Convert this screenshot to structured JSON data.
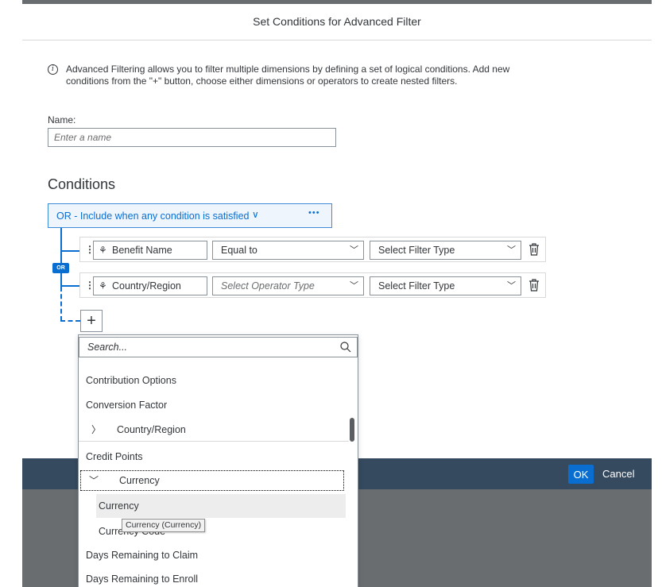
{
  "dialog": {
    "title": "Set Conditions for Advanced Filter",
    "info_text_line1": "Advanced Filtering allows you to filter multiple dimensions by defining a set of logical conditions. Add new",
    "info_text_line2": "conditions from the \"+\" button, choose either dimensions or operators to create nested filters.",
    "name_label": "Name:",
    "name_placeholder": "Enter a name",
    "name_value": "",
    "conditions_heading": "Conditions"
  },
  "group": {
    "label": "OR - Include when any condition is satisfied",
    "chevron": "∨",
    "more": "•••",
    "badge": "OR"
  },
  "conditions": [
    {
      "dimension": "Benefit Name",
      "operator": "Equal to",
      "operator_is_placeholder": false,
      "filter_type": "Select Filter Type"
    },
    {
      "dimension": "Country/Region",
      "operator": "Select Operator Type",
      "operator_is_placeholder": true,
      "filter_type": "Select Filter Type"
    }
  ],
  "add_button": "+",
  "dropdown": {
    "search_placeholder": "Search...",
    "items": [
      {
        "label": "Contribution Options",
        "kind": "item"
      },
      {
        "label": "Conversion Factor",
        "kind": "item"
      },
      {
        "label": "Country/Region",
        "kind": "collapsed"
      },
      {
        "label": "Credit Points",
        "kind": "item"
      },
      {
        "label": "Currency",
        "kind": "expanded"
      },
      {
        "label": "Currency",
        "kind": "child"
      },
      {
        "label": "Currency Code",
        "kind": "child"
      },
      {
        "label": "Days Remaining to Claim",
        "kind": "item"
      },
      {
        "label": "Days Remaining to Enroll",
        "kind": "item"
      }
    ],
    "tooltip": "Currency (Currency)"
  },
  "footer": {
    "ok_label": "OK",
    "cancel_label": "Cancel"
  },
  "colors": {
    "accent": "#0a6ed1",
    "footer_bar": "#354a5f",
    "backdrop": "#6a6d70"
  }
}
